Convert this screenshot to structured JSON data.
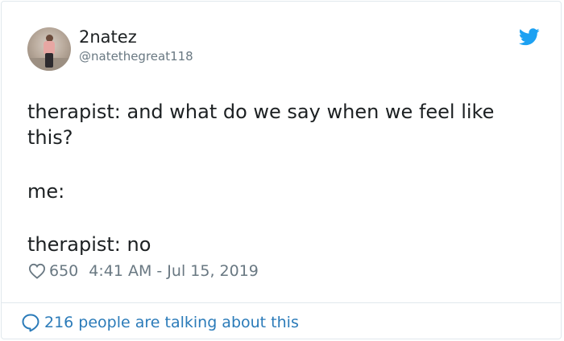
{
  "author": {
    "display_name": "2natez",
    "handle": "@natethegreat118"
  },
  "tweet": {
    "line1": "therapist: and what do we say when we feel like",
    "line2": "this?",
    "line3": "me:",
    "line4": "therapist: no"
  },
  "meta": {
    "likes": "650",
    "timestamp": "4:41 AM - Jul 15, 2019"
  },
  "footer": {
    "talking": "216 people are talking about this"
  },
  "colors": {
    "brand": "#1da1f2",
    "link": "#2b7bb9",
    "muted": "#697882",
    "text": "#1c2022"
  },
  "icons": {
    "logo": "twitter-bird-icon",
    "like": "heart-icon",
    "reply": "speech-bubble-icon"
  }
}
